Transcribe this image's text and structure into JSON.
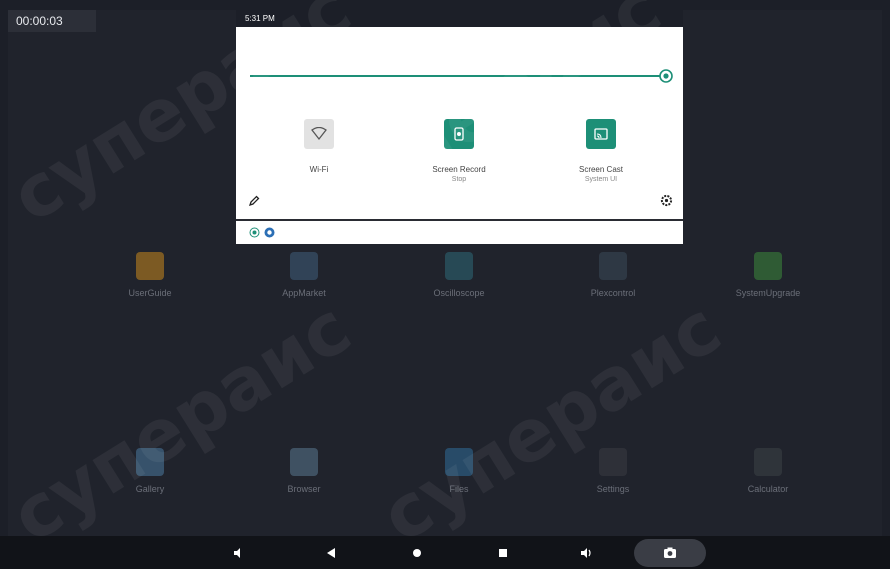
{
  "timer": "00:00:03",
  "status_time": "5:31 PM",
  "brightness_level": 0.99,
  "tiles": [
    {
      "label": "Wi-Fi",
      "sub": "",
      "active": false
    },
    {
      "label": "Screen Record",
      "sub": "Stop",
      "active": true
    },
    {
      "label": "Screen Cast",
      "sub": "System UI",
      "active": true
    }
  ],
  "apps_row1": [
    "UserGuide",
    "AppMarket",
    "Oscilloscope",
    "Plexcontrol",
    "SystemUpgrade"
  ],
  "apps_row2": [
    "Gallery",
    "Browser",
    "Files",
    "Settings",
    "Calculator"
  ],
  "watermark": "супераис",
  "colors": {
    "accent": "#1d8f77",
    "background": "#20232c",
    "panel": "#ffffff"
  }
}
